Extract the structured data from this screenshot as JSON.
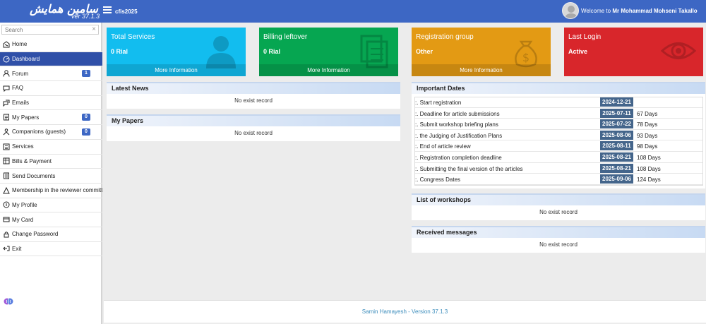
{
  "header": {
    "logo_text": "سامین همایش",
    "version": "ver 37.1.3",
    "conference": "cfis2025",
    "welcome_prefix": "Welcome to",
    "user_name": "Mr Mohammad Mohseni Takallo"
  },
  "sidebar": {
    "search_placeholder": "Search",
    "items": [
      {
        "label": "Home",
        "icon": "home-icon"
      },
      {
        "label": "Dashboard",
        "icon": "dashboard-icon",
        "active": true
      },
      {
        "label": "Forum",
        "icon": "user-icon",
        "badge": "1"
      },
      {
        "label": "FAQ",
        "icon": "chat-icon"
      },
      {
        "label": "Emails",
        "icon": "mail-icon"
      },
      {
        "label": "My Papers",
        "icon": "paper-icon",
        "badge": "0"
      },
      {
        "label": "Companions (guests)",
        "icon": "people-icon",
        "badge": "0"
      },
      {
        "label": "Services",
        "icon": "services-icon"
      },
      {
        "label": "Bills & Payment",
        "icon": "bills-icon"
      },
      {
        "label": "Send Documents",
        "icon": "document-icon"
      },
      {
        "label": "Membership in the reviewer committee",
        "icon": "committee-icon"
      },
      {
        "label": "My Profile",
        "icon": "profile-icon"
      },
      {
        "label": "My Card",
        "icon": "card-icon"
      },
      {
        "label": "Change Password",
        "icon": "lock-icon"
      },
      {
        "label": "Exit",
        "icon": "exit-icon"
      }
    ]
  },
  "cards": [
    {
      "title": "Total Services",
      "value": "0 Rial",
      "more": "More Information",
      "color": "#12bdef",
      "icon": "person-icon"
    },
    {
      "title": "Billing leftover",
      "value": "0 Rial",
      "more": "More Information",
      "color": "#06a651",
      "icon": "documents-icon"
    },
    {
      "title": "Registration group",
      "value": "Other",
      "more": "More Information",
      "color": "#e39a14",
      "icon": "money-bag-icon"
    },
    {
      "title": "Last Login",
      "value": "Active",
      "color": "#d8262b",
      "icon": "eye-icon"
    }
  ],
  "news": {
    "title": "Latest News",
    "empty": "No exist record"
  },
  "papers": {
    "title": "My Papers",
    "empty": "No exist record"
  },
  "important_dates": {
    "title": "Important Dates",
    "rows": [
      {
        "label": ":. Start registration",
        "date": "2024-12-21",
        "days": ""
      },
      {
        "label": ":. Deadline for article submissions",
        "date": "2025-07-11",
        "days": "67 Days"
      },
      {
        "label": ":. Submit workshop briefing plans",
        "date": "2025-07-22",
        "days": "78 Days"
      },
      {
        "label": ":. the Judging of Justification Plans",
        "date": "2025-08-06",
        "days": "93 Days"
      },
      {
        "label": ":. End of article review",
        "date": "2025-08-11",
        "days": "98 Days"
      },
      {
        "label": ":. Registration completion deadline",
        "date": "2025-08-21",
        "days": "108 Days"
      },
      {
        "label": ":. Submitting the final version of the articles",
        "date": "2025-08-21",
        "days": "108 Days"
      },
      {
        "label": ":. Congress Dates",
        "date": "2025-09-06",
        "days": "124 Days"
      }
    ]
  },
  "workshops": {
    "title": "List of workshops",
    "empty": "No exist record"
  },
  "messages": {
    "title": "Received messages",
    "empty": "No exist record"
  },
  "footer": {
    "text": "Samin Hamayesh - Version 37.1.3"
  }
}
